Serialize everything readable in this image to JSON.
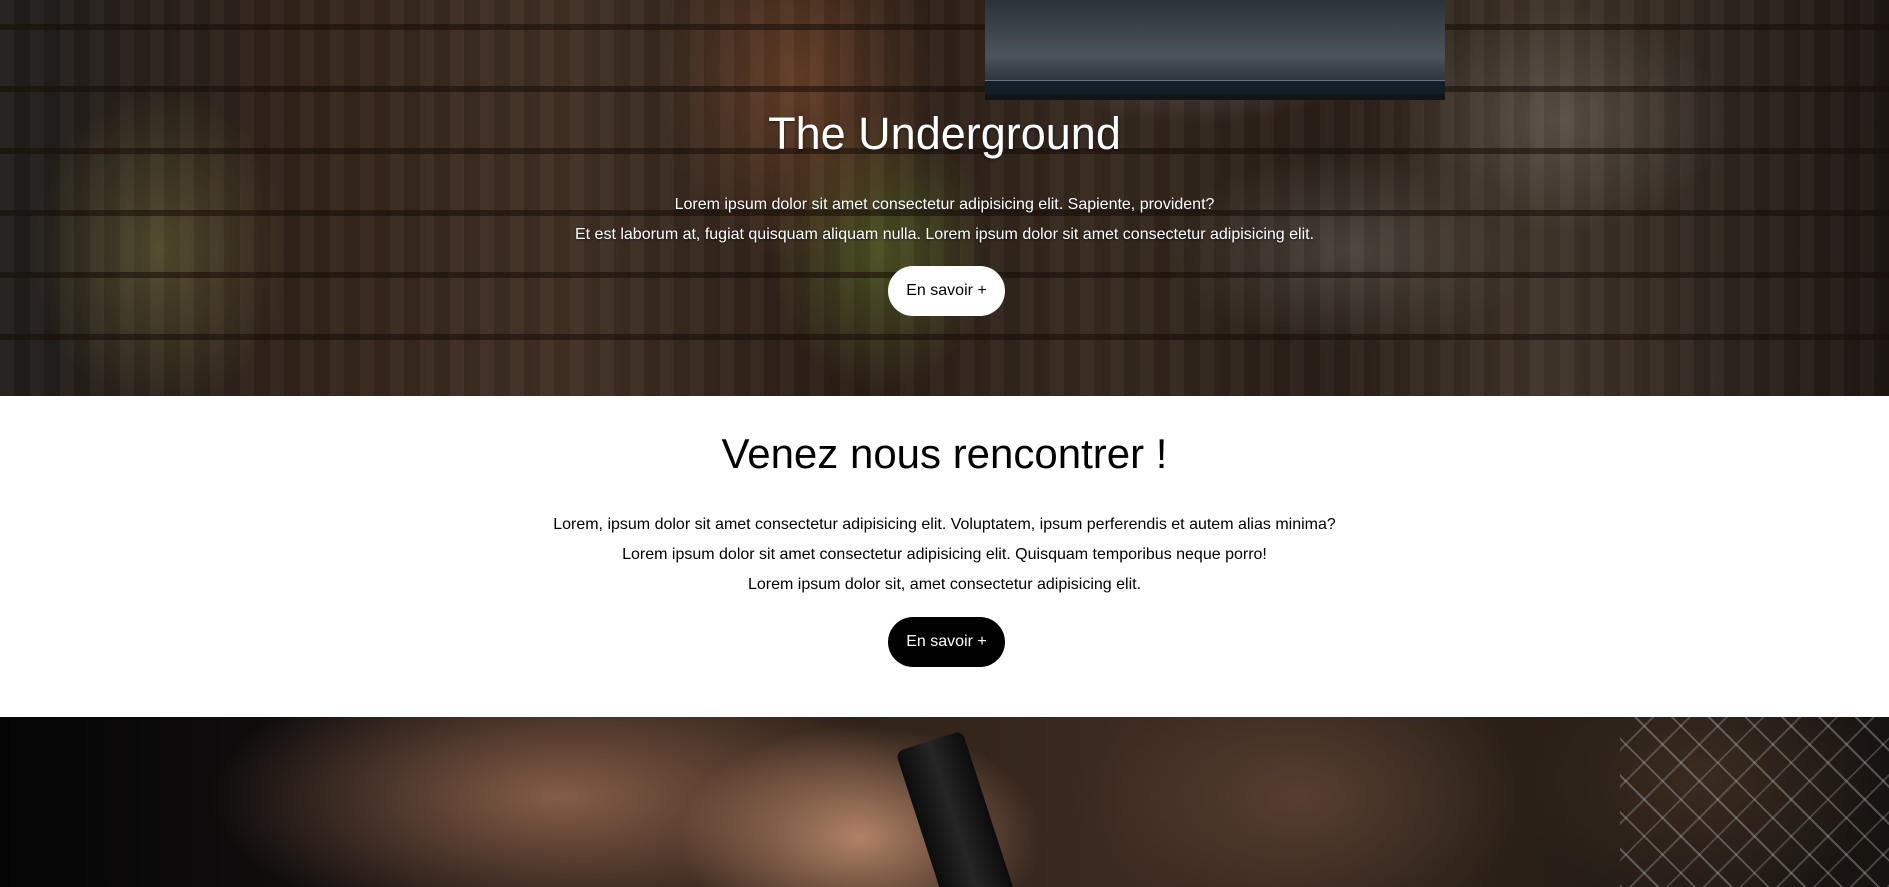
{
  "hero": {
    "title": "The Underground",
    "lines": [
      "Lorem ipsum dolor sit amet consectetur adipisicing elit. Sapiente, provident?",
      "Et est laborum at, fugiat quisquam aliquam nulla. Lorem ipsum dolor sit amet consectetur adipisicing elit."
    ],
    "button_label": "En savoir +",
    "background_image": "bar interior with bottles, shelves and a TV screen"
  },
  "meet": {
    "title": "Venez nous rencontrer !",
    "lines": [
      "Lorem, ipsum dolor sit amet consectetur adipisicing elit. Voluptatem, ipsum perferendis et autem alias minima?",
      "Lorem ipsum dolor sit amet consectetur adipisicing elit. Quisquam temporibus neque porro!",
      "Lorem ipsum dolor sit, amet consectetur adipisicing elit."
    ],
    "button_label": "En savoir +"
  },
  "bottom": {
    "background_image": "close-up of a hand in a dark bar setting"
  },
  "colors": {
    "hero_text": "#ffffff",
    "light_button_bg": "#ffffff",
    "dark_button_bg": "#000000",
    "section_bg": "#ffffff",
    "body_text": "#000000"
  }
}
